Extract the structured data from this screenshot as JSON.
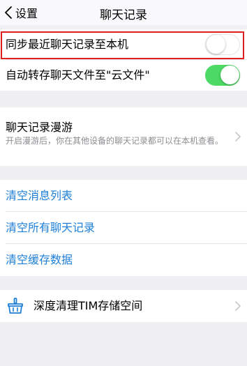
{
  "nav": {
    "back_label": "设置",
    "title": "聊天记录"
  },
  "sync_section": {
    "sync_recent": {
      "label": "同步最近聊天记录至本机",
      "enabled": false
    },
    "auto_save_files": {
      "label": "自动转存聊天文件至\"云文件\"",
      "enabled": true
    }
  },
  "roaming": {
    "title": "聊天记录漫游",
    "description": "开启漫游后，你在其他设备的聊天记录都可以在本机查看。"
  },
  "clear_actions": {
    "clear_message_list": "清空消息列表",
    "clear_all_chat_records": "清空所有聊天记录",
    "clear_cache": "清空缓存数据"
  },
  "storage": {
    "deep_clean_label": "深度清理TIM存储空间",
    "icon": "broom-basket-icon"
  },
  "colors": {
    "link_blue": "#1e7fd8",
    "toggle_on": "#4cd964",
    "highlight_red": "#e02020"
  }
}
